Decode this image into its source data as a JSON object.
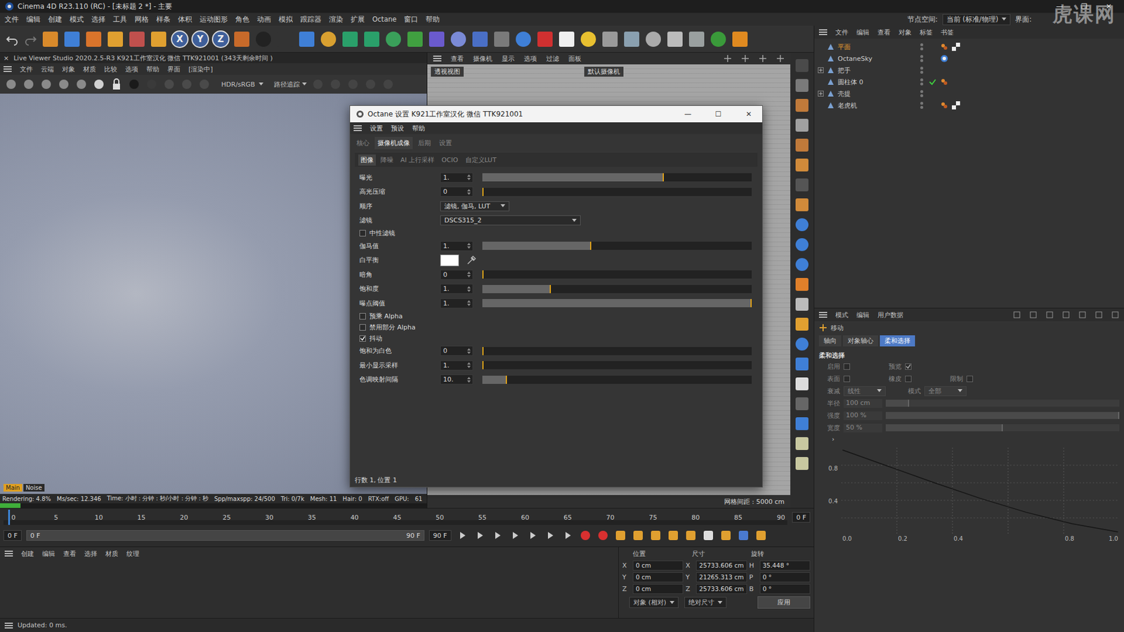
{
  "window": {
    "title": "Cinema 4D R23.110 (RC) - [未标题 2 *] - 主要",
    "controls": [
      "—",
      "❐",
      "✕"
    ]
  },
  "menubar": {
    "items": [
      "文件",
      "编辑",
      "创建",
      "模式",
      "选择",
      "工具",
      "网格",
      "样条",
      "体积",
      "运动图形",
      "角色",
      "动画",
      "模拟",
      "跟踪器",
      "渲染",
      "扩展",
      "Octane",
      "窗口",
      "帮助"
    ],
    "node_space_label": "节点空间:",
    "node_space_value": "当前 (标准/物理)",
    "layout_label": "界面:"
  },
  "watermark": "虎课网",
  "toolbar": {
    "axes": [
      "X",
      "Y",
      "Z"
    ]
  },
  "live_viewer": {
    "close": "×",
    "title": "Live Viewer Studio 2020.2.5-R3  K921工作室汉化  微信  TTK921001   (343天剩余时间 )",
    "menu": [
      "文件",
      "云端",
      "对象",
      "材质",
      "比较",
      "选项",
      "帮助",
      "界面"
    ],
    "state": "[渲染中]",
    "color_space": "HDR/sRGB",
    "kernel": "路径追踪",
    "badges": [
      "Main",
      "Noise"
    ],
    "status": [
      "Rendering: 4.8%",
      "Ms/sec: 12.346",
      "Time: 小时 : 分钟 : 秒/小时 : 分钟 : 秒",
      "Spp/maxspp: 24/500",
      "Tri: 0/7k",
      "Mesh: 11",
      "Hair: 0",
      "RTX:off",
      "GPU:",
      "61"
    ],
    "progress": 0.048
  },
  "viewport": {
    "menu": [
      "查看",
      "摄像机",
      "显示",
      "选项",
      "过滤",
      "面板"
    ],
    "view_name": "透视视图",
    "camera": "默认摄像机",
    "grid": "网格间距 : 5000 cm"
  },
  "octane": {
    "title": "Octane 设置  K921工作室汉化  微信  TTK921001",
    "controls": [
      "—",
      "☐",
      "✕"
    ],
    "menu": [
      "设置",
      "预设",
      "帮助"
    ],
    "tabs": [
      {
        "label": "核心",
        "selected": false
      },
      {
        "label": "摄像机成像",
        "selected": true
      },
      {
        "label": "后期",
        "selected": false
      },
      {
        "label": "设置",
        "selected": false
      }
    ],
    "subtabs": [
      {
        "label": "图像",
        "selected": true
      },
      {
        "label": "降噪",
        "selected": false
      },
      {
        "label": "AI 上行采样",
        "selected": false
      },
      {
        "label": "OCIO",
        "selected": false
      },
      {
        "label": "自定义LUT",
        "selected": false
      }
    ],
    "rows": [
      {
        "kind": "slider",
        "label": "曝光",
        "value": "1.",
        "level": 0.67
      },
      {
        "kind": "slider",
        "label": "高光压缩",
        "value": "0",
        "level": 0
      },
      {
        "kind": "dropdown",
        "label": "顺序",
        "value": "滤镜, 伽马, LUT"
      },
      {
        "kind": "dropdown",
        "label": "滤镜",
        "value": "DSCS315_2"
      },
      {
        "kind": "checkbox",
        "label": "中性滤镜",
        "checked": false
      },
      {
        "kind": "slider",
        "label": "伽马值",
        "value": "1.",
        "level": 0.4
      },
      {
        "kind": "color",
        "label": "白平衡",
        "color": "#ffffff"
      },
      {
        "kind": "slider",
        "label": "暗角",
        "value": "0",
        "level": 0
      },
      {
        "kind": "slider",
        "label": "饱和度",
        "value": "1.",
        "level": 0.25
      },
      {
        "kind": "slider",
        "label": "曝点阈值",
        "value": "1.",
        "level": 1
      },
      {
        "kind": "checkbox",
        "label": "预乘 Alpha",
        "checked": false
      },
      {
        "kind": "checkbox",
        "label": "禁用部分 Alpha",
        "checked": false
      },
      {
        "kind": "checkbox",
        "label": "抖动",
        "checked": true
      },
      {
        "kind": "slider",
        "label": "饱和为白色",
        "value": "0",
        "level": 0
      },
      {
        "kind": "slider",
        "label": "最小显示采样",
        "value": "1.",
        "level": 0
      },
      {
        "kind": "slider",
        "label": "色调映射间隔",
        "value": "10.",
        "level": 0.087
      }
    ],
    "footer": "行数 1, 位置 1"
  },
  "objects": {
    "menu": [
      "文件",
      "编辑",
      "查看",
      "对象",
      "标签",
      "书签"
    ],
    "items": [
      {
        "name": "平面",
        "selected": true,
        "expandable": false,
        "enabled": false,
        "tags": [
          "material",
          "checker"
        ]
      },
      {
        "name": "OctaneSky",
        "selected": false,
        "expandable": false,
        "enabled": false,
        "tags": [
          "sky"
        ]
      },
      {
        "name": "把手",
        "selected": false,
        "expandable": true,
        "enabled": false,
        "tags": []
      },
      {
        "name": "圆柱体 0",
        "selected": false,
        "expandable": false,
        "enabled": true,
        "tags": [
          "material"
        ]
      },
      {
        "name": "壳提",
        "selected": false,
        "expandable": true,
        "enabled": false,
        "tags": []
      },
      {
        "name": "老虎机",
        "selected": false,
        "expandable": false,
        "enabled": false,
        "tags": [
          "material",
          "checker"
        ]
      }
    ]
  },
  "attributes": {
    "menu": [
      "模式",
      "编辑",
      "用户数据"
    ],
    "tool": "移动",
    "tabs": [
      {
        "label": "轴向",
        "selected": false
      },
      {
        "label": "对象轴心",
        "selected": false
      },
      {
        "label": "柔和选择",
        "selected": true
      }
    ],
    "section": "柔和选择",
    "checkbox_rows": [
      [
        {
          "label": "启用",
          "checked": false,
          "disabled": true
        },
        {
          "label": "预览",
          "checked": true,
          "disabled": true
        }
      ],
      [
        {
          "label": "表面",
          "checked": false,
          "disabled": true
        },
        {
          "label": "橡皮",
          "checked": false,
          "disabled": true
        },
        {
          "label": "限制",
          "checked": false,
          "disabled": true
        }
      ]
    ],
    "dropdowns": [
      {
        "label": "衰减",
        "value": "线性",
        "disabled": true
      },
      {
        "label": "模式",
        "value": "全部",
        "disabled": true
      }
    ],
    "sliders": [
      {
        "label": "半径",
        "value": "100 cm",
        "level": 0.1,
        "disabled": true
      },
      {
        "label": "强度",
        "value": "100 %",
        "level": 1,
        "disabled": true
      },
      {
        "label": "宽度",
        "value": "50 %",
        "level": 0.5,
        "disabled": true
      }
    ],
    "expander": "›",
    "graph": {
      "y_ticks": [
        "0.8",
        "0.4"
      ],
      "x_ticks": [
        "0.0",
        "0.2",
        "0.4",
        "0.8",
        "1.0"
      ],
      "curve": [
        1.0,
        0.8,
        0.6,
        0.41,
        0.24,
        0.1,
        0.0
      ]
    }
  },
  "timeline": {
    "ticks": [
      "0",
      "5",
      "10",
      "15",
      "20",
      "25",
      "30",
      "35",
      "40",
      "45",
      "50",
      "55",
      "60",
      "65",
      "70",
      "75",
      "80",
      "85",
      "90"
    ],
    "current": "0 F",
    "playhead": 0,
    "range": [
      "0 F",
      "0 F",
      "90 F",
      "90 F"
    ]
  },
  "materials": {
    "menu": [
      "创建",
      "编辑",
      "查看",
      "选择",
      "材质",
      "纹理"
    ]
  },
  "coords": {
    "headers": [
      "位置",
      "尺寸",
      "旋转"
    ],
    "rows": [
      {
        "axis": "X",
        "position": "0 cm",
        "size_axis": "X",
        "size": "25733.606 cm",
        "rot_axis": "H",
        "rotation": "35.448 °"
      },
      {
        "axis": "Y",
        "position": "0 cm",
        "size_axis": "Y",
        "size": "21265.313 cm",
        "rot_axis": "P",
        "rotation": "0 °"
      },
      {
        "axis": "Z",
        "position": "0 cm",
        "size_axis": "Z",
        "size": "25733.606 cm",
        "rot_axis": "B",
        "rotation": "0 °"
      }
    ],
    "mode": "对象 (相对)",
    "size_mode": "绝对尺寸",
    "apply": "应用"
  },
  "status_bar": "Updated: 0 ms."
}
